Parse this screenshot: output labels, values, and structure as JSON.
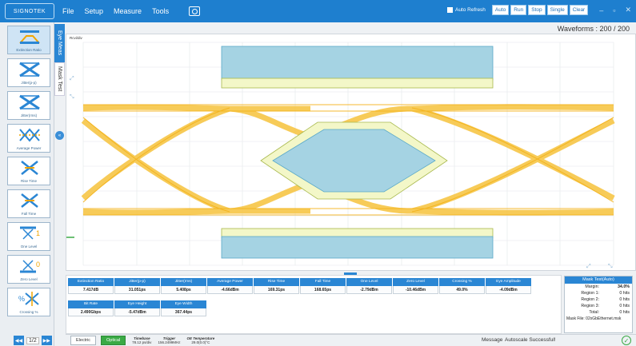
{
  "app": {
    "logo_text": "SIGNOTEK",
    "menu": [
      "File",
      "Setup",
      "Measure",
      "Tools"
    ],
    "auto_refresh_label": "Auto Refresh",
    "toolbar_buttons": [
      "Auto",
      "Run",
      "Stop",
      "Single",
      "Clear"
    ]
  },
  "sidebar": {
    "tools": [
      {
        "label": "Extinction Ratio",
        "icon": "extinction-ratio-icon",
        "selected": true
      },
      {
        "label": "Jitter(p-p)",
        "icon": "jitter-pp-icon"
      },
      {
        "label": "Jitter(rms)",
        "icon": "jitter-rms-icon"
      },
      {
        "label": "Average Power",
        "icon": "average-power-icon"
      },
      {
        "label": "Rise Time",
        "icon": "rise-time-icon"
      },
      {
        "label": "Fall Time",
        "icon": "fall-time-icon"
      },
      {
        "label": "One Level",
        "icon": "one-level-icon"
      },
      {
        "label": "Zero Level",
        "icon": "zero-level-icon"
      },
      {
        "label": "Crossing %",
        "icon": "crossing-icon"
      }
    ],
    "page": "1/2"
  },
  "tabs": {
    "tab1": "Eye Meas",
    "tab2": "Mask Test"
  },
  "waveforms": {
    "label": "Waveforms : 200 / 200"
  },
  "scale_text": "Rcvi/div",
  "measurements": [
    {
      "name": "Extinction Ratio",
      "value": "7.417dB"
    },
    {
      "name": "Jitter(p-p)",
      "value": "31.051ps"
    },
    {
      "name": "Jitter(rms)",
      "value": "5.408ps"
    },
    {
      "name": "Average Power",
      "value": "-4.66dBm"
    },
    {
      "name": "Rise Time",
      "value": "169.31ps"
    },
    {
      "name": "Fall Time",
      "value": "168.65ps"
    },
    {
      "name": "One Level",
      "value": "-2.79dBm"
    },
    {
      "name": "Zero Level",
      "value": "-10.46dBm"
    },
    {
      "name": "Crossing %",
      "value": "49.0%"
    },
    {
      "name": "Eye Amplitude",
      "value": "-4.09dBm"
    },
    {
      "name": "Bit Rate",
      "value": "2.490Gbps"
    },
    {
      "name": "Eye Height",
      "value": "-5.47dBm"
    },
    {
      "name": "Eye Width",
      "value": "367.44ps"
    }
  ],
  "mask_test": {
    "title": "Mask Test(Auto)",
    "rows": [
      {
        "key": "Margin:",
        "value": "34.0%",
        "highlight": true
      },
      {
        "key": "Region 1:",
        "value": "0 hits"
      },
      {
        "key": "Region 2:",
        "value": "0 hits"
      },
      {
        "key": "Region 3:",
        "value": "0 hits"
      },
      {
        "key": "Total:",
        "value": "0 hits"
      }
    ],
    "file": "Mask File: 02xGbEthernet.msk"
  },
  "status": {
    "electric": "Electric",
    "optical": "Optical",
    "timebase_label": "Timebase",
    "timebase_value": "78.12 ps/div",
    "trigger_label": "Trigger",
    "trigger_value": "156.2499MHz",
    "oe_label": "OE Temperature",
    "oe_value": "29.0(0.0)°C",
    "message_label": "Message",
    "message_value": "Autoscale Successful!"
  },
  "colors": {
    "accent": "#2a86d4",
    "eye": "#f6c33c",
    "mask_blue": "#a5d3e3",
    "mask_yellow": "#f3f7c8"
  }
}
